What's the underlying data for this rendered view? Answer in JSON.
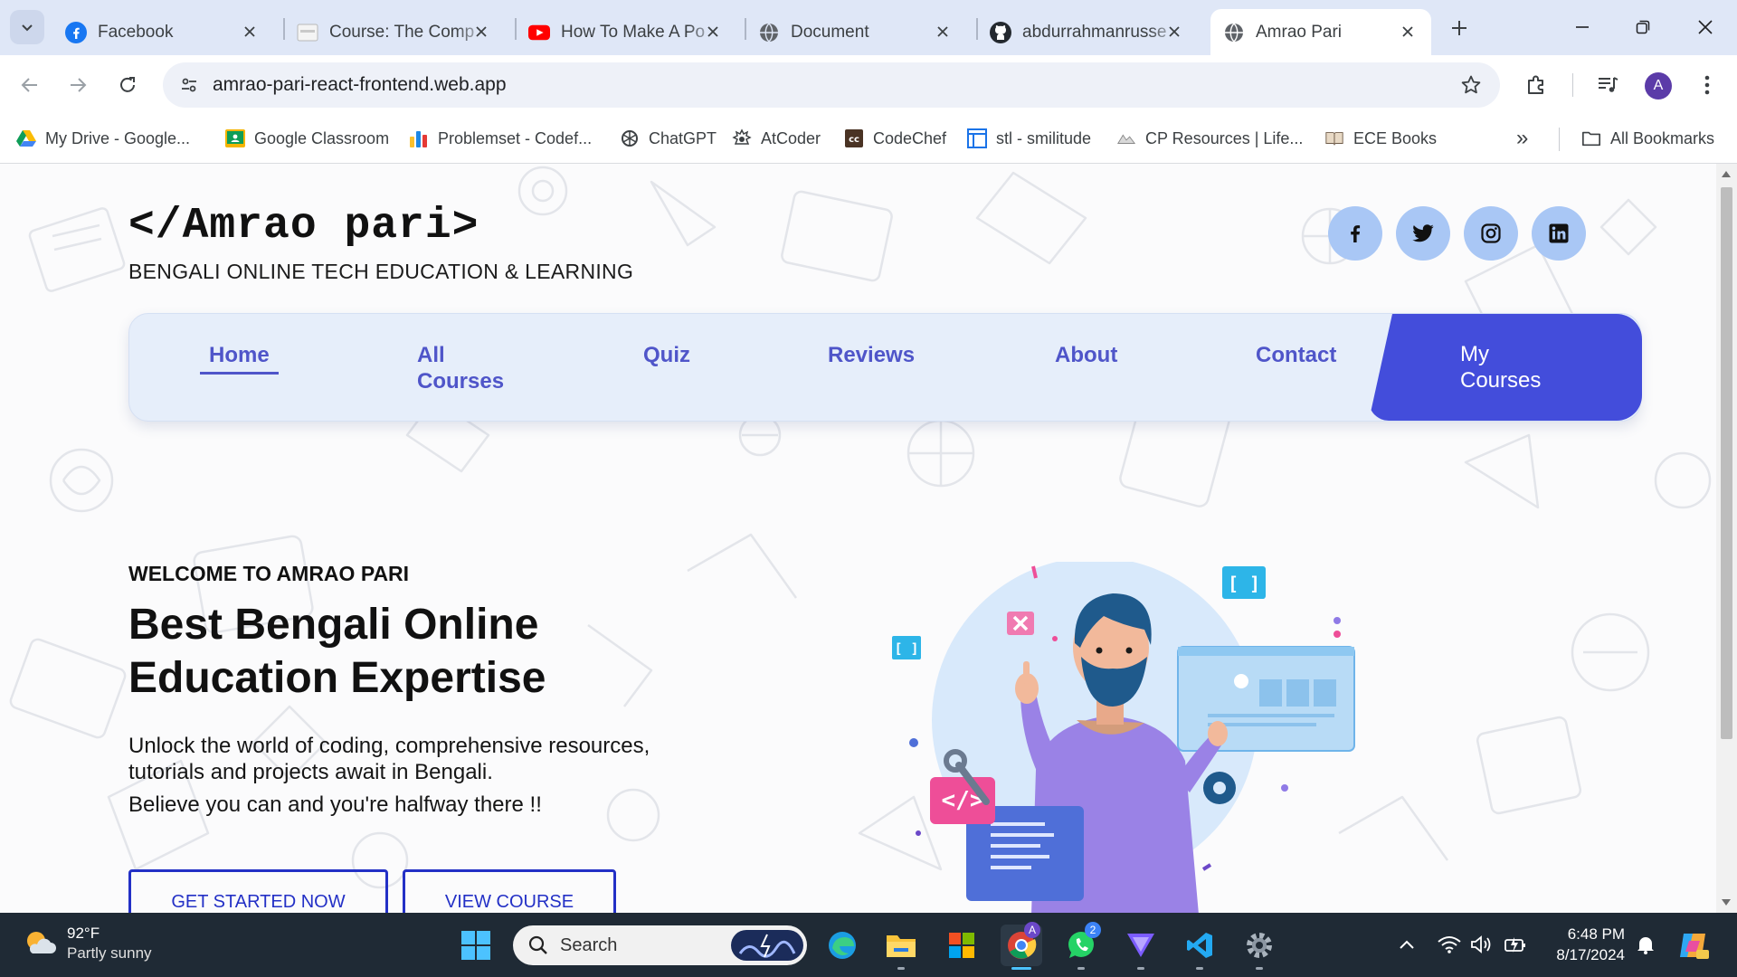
{
  "browser": {
    "tabs": [
      {
        "title": "Facebook",
        "favicon": "facebook-icon",
        "active": false
      },
      {
        "title": "Course: The Comp",
        "favicon": "course-site-icon",
        "active": false
      },
      {
        "title": "How To Make A Po",
        "favicon": "youtube-icon",
        "active": false
      },
      {
        "title": "Document",
        "favicon": "globe-icon",
        "active": false
      },
      {
        "title": "abdurrahmanrusse",
        "favicon": "github-icon",
        "active": false
      },
      {
        "title": "Amrao Pari",
        "favicon": "globe-icon",
        "active": true
      }
    ],
    "url": "amrao-pari-react-frontend.web.app",
    "profile_initial": "A",
    "bookmarks": [
      {
        "label": "My Drive - Google...",
        "icon": "google-drive-icon"
      },
      {
        "label": "Google Classroom",
        "icon": "classroom-icon"
      },
      {
        "label": "Problemset - Codef...",
        "icon": "codeforces-icon"
      },
      {
        "label": "ChatGPT",
        "icon": "chatgpt-icon"
      },
      {
        "label": "AtCoder",
        "icon": "atcoder-icon"
      },
      {
        "label": "CodeChef",
        "icon": "codechef-icon"
      },
      {
        "label": "stl - smilitude",
        "icon": "blog-icon"
      },
      {
        "label": "CP Resources | Life...",
        "icon": "life-icon"
      },
      {
        "label": "ECE Books",
        "icon": "book-icon"
      }
    ],
    "all_bookmarks_label": "All Bookmarks",
    "overflow_label": "»"
  },
  "site": {
    "logo": "</Amrao pari>",
    "tagline": "BENGALI ONLINE TECH EDUCATION & LEARNING",
    "social": [
      "facebook-icon",
      "twitter-icon",
      "instagram-icon",
      "linkedin-icon"
    ],
    "nav": {
      "home": "Home",
      "all_courses_1": "All",
      "all_courses_2": "Courses",
      "quiz": "Quiz",
      "reviews": "Reviews",
      "about": "About",
      "contact": "Contact",
      "my_courses_1": "My",
      "my_courses_2": "Courses"
    },
    "hero": {
      "kicker": "WELCOME TO AMRAO PARI",
      "headline_1": "Best Bengali Online",
      "headline_2": "Education Expertise",
      "desc_1": "Unlock the world of coding, comprehensive resources,",
      "desc_2": "tutorials and projects await in Bengali.",
      "desc_3": "Believe you can and you're halfway there !!",
      "cta_primary": "GET STARTED NOW",
      "cta_secondary": "VIEW COURSE",
      "art_tags": [
        "[ ]",
        "[ ]",
        "</>"
      ]
    },
    "colors": {
      "accent": "#434ddb",
      "nav_text": "#4f55c9",
      "cta_border": "#2330c6",
      "social_bg": "#a9c7f5"
    }
  },
  "taskbar": {
    "weather": {
      "temp": "92°F",
      "condition": "Partly sunny"
    },
    "search_placeholder": "Search",
    "whatsapp_badge": "2",
    "time": "6:48 PM",
    "date": "8/17/2024"
  }
}
